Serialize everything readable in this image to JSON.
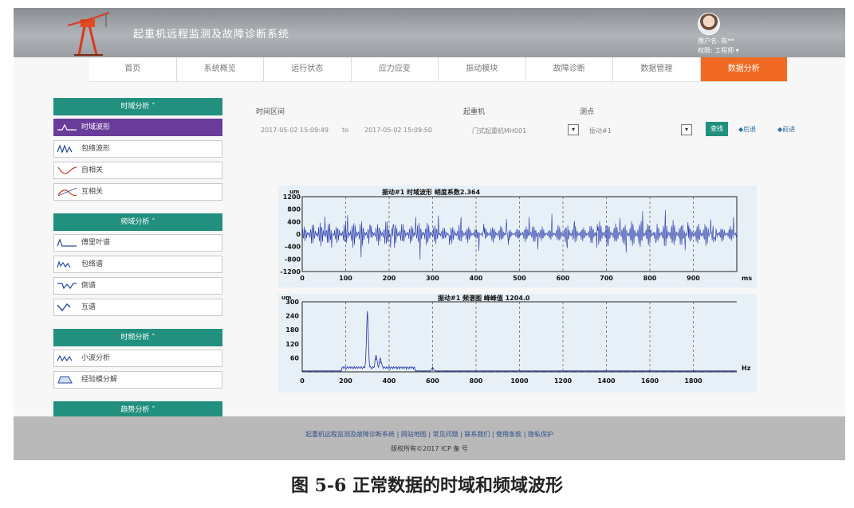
{
  "header": {
    "title": "起重机远程监测及故障诊断系统",
    "user_label": "用户名: 陈**",
    "role_label": "权限: 工程师 ▾"
  },
  "nav": {
    "tabs": [
      {
        "label": "首页",
        "active": false
      },
      {
        "label": "系统概览",
        "active": false
      },
      {
        "label": "运行状态",
        "active": false
      },
      {
        "label": "应力应变",
        "active": false
      },
      {
        "label": "振动模块",
        "active": false
      },
      {
        "label": "故障诊断",
        "active": false
      },
      {
        "label": "数据管理",
        "active": false
      },
      {
        "label": "数据分析",
        "active": true
      }
    ]
  },
  "sidebar": {
    "groups": [
      {
        "title": "时域分析 ˄",
        "items": [
          {
            "label": "时域波形",
            "icon": "time-wave-icon",
            "active": true
          },
          {
            "label": "包络波形",
            "icon": "envelope-wave-icon",
            "active": false
          },
          {
            "label": "自相关",
            "icon": "autocorrelation-icon",
            "active": false
          },
          {
            "label": "互相关",
            "icon": "crosscorrelation-icon",
            "active": false
          }
        ]
      },
      {
        "title": "频域分析 ˄",
        "items": [
          {
            "label": "傅里叶谱",
            "icon": "fourier-spectrum-icon",
            "active": false
          },
          {
            "label": "包络谱",
            "icon": "envelope-spectrum-icon",
            "active": false
          },
          {
            "label": "倒谱",
            "icon": "cepstrum-icon",
            "active": false
          },
          {
            "label": "互谱",
            "icon": "cross-spectrum-icon",
            "active": false
          }
        ]
      },
      {
        "title": "时频分析 ˄",
        "items": [
          {
            "label": "小波分析",
            "icon": "wavelet-icon",
            "active": false
          },
          {
            "label": "经验模分解",
            "icon": "emd-icon",
            "active": false
          }
        ]
      },
      {
        "title": "趋势分析 ˅",
        "items": []
      }
    ]
  },
  "filters": {
    "time_range_label": "时间区间",
    "start_time": "2017-05-02 15:09:49",
    "separator": "to",
    "end_time": "2017-05-02 15:09:50",
    "crane_label": "起重机",
    "crane_value": "门式起重机MH001",
    "point_label": "测点",
    "point_value": "振动#1",
    "query_label": "查找",
    "prev_label": "◆后退",
    "next_label": "◆前进"
  },
  "colors": {
    "header_bg": "#9fa2a6",
    "accent_orange": "#f16a24",
    "accent_teal": "#22907e",
    "active_side": "#6a3c9a",
    "signal_blue": "#2233aa",
    "chart_bg": "#e7f0f6"
  },
  "chart_data": [
    {
      "type": "line",
      "title": "振动#1 时域波形 峭度系数2.364",
      "ylabel": "um",
      "xlabel": "ms",
      "xlim": [
        0,
        1000
      ],
      "ylim": [
        -1200,
        1200
      ],
      "yticks": [
        1200,
        800,
        400,
        0,
        -400,
        -800,
        -1200
      ],
      "xticks": [
        0,
        100,
        200,
        300,
        400,
        500,
        600,
        700,
        800,
        900
      ],
      "signal": "dense vibration oscillating mostly within -400 to 400 with peaks near ±600",
      "grid": "vertical dashed"
    },
    {
      "type": "line",
      "title": "振动#1 频谱图 峰峰值 1204.0",
      "ylabel": "um",
      "xlabel": "Hz",
      "xlim": [
        0,
        2000
      ],
      "ylim": [
        0,
        300
      ],
      "yticks": [
        300,
        240,
        180,
        120,
        60
      ],
      "xticks": [
        0,
        200,
        400,
        600,
        800,
        1000,
        1200,
        1400,
        1600,
        1800
      ],
      "peaks": [
        {
          "x": 300,
          "y": 245
        },
        {
          "x": 340,
          "y": 55
        },
        {
          "x": 360,
          "y": 40
        },
        {
          "x": 600,
          "y": 15
        }
      ],
      "grid": "vertical dashed"
    }
  ],
  "footer": {
    "links": "起重机远程监测及故障诊断系统 | 网站地图 | 常见问题 | 联系我们 | 使用条款 | 隐私保护",
    "copyright": "版权所有©2017 ICP 备 号"
  },
  "caption": "图 5-6 正常数据的时域和频域波形"
}
